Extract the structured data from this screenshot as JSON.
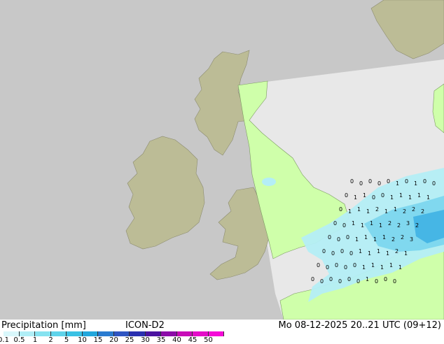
{
  "footer": {
    "title": "Precipitation [mm]",
    "model": "ICON-D2",
    "valid": "Mo 08-12-2025 20..21 UTC (09+12)"
  },
  "legend": {
    "ticks": [
      "0.1",
      "0.5",
      "1",
      "2",
      "5",
      "10",
      "15",
      "20",
      "25",
      "30",
      "35",
      "40",
      "45",
      "50"
    ],
    "colors": [
      "#d9f7fb",
      "#b0eef6",
      "#86e2f0",
      "#5fd3ea",
      "#3ac1e4",
      "#23a7dc",
      "#2a7bd0",
      "#2f55c2",
      "#2a2fb0",
      "#4b12a0",
      "#8c0ca8",
      "#c80cb8",
      "#e40cc8",
      "#f50ad8"
    ]
  },
  "map": {
    "colors": {
      "sea_outside": "#c8c8c8",
      "land_outside": "#bcbc96",
      "sea_domain": "#e8e8e8",
      "land_domain": "#cfffaa",
      "rain_light": "#b4eef6",
      "rain_mid": "#7cd6ee",
      "rain_heavy": "#42b4e4"
    },
    "grid_values": [
      {
        "v": "0"
      },
      {
        "v": "0"
      },
      {
        "v": "0"
      },
      {
        "v": "0"
      },
      {
        "v": "0"
      },
      {
        "v": "1"
      },
      {
        "v": "0"
      },
      {
        "v": "1"
      },
      {
        "v": "0"
      },
      {
        "v": "0"
      },
      {
        "v": "0"
      },
      {
        "v": "1"
      },
      {
        "v": "1"
      },
      {
        "v": "0"
      },
      {
        "v": "0"
      },
      {
        "v": "1"
      },
      {
        "v": "1"
      },
      {
        "v": "1"
      },
      {
        "v": "1"
      },
      {
        "v": "1"
      },
      {
        "v": "0"
      },
      {
        "v": "1"
      },
      {
        "v": "1"
      },
      {
        "v": "1"
      },
      {
        "v": "2"
      },
      {
        "v": "1"
      },
      {
        "v": "1"
      },
      {
        "v": "2"
      },
      {
        "v": "2"
      },
      {
        "v": "2"
      },
      {
        "v": "0"
      },
      {
        "v": "0"
      },
      {
        "v": "1"
      },
      {
        "v": "1"
      },
      {
        "v": "1"
      },
      {
        "v": "1"
      },
      {
        "v": "2"
      },
      {
        "v": "2"
      },
      {
        "v": "3"
      },
      {
        "v": "2"
      },
      {
        "v": "0"
      },
      {
        "v": "0"
      },
      {
        "v": "0"
      },
      {
        "v": "1"
      },
      {
        "v": "1"
      },
      {
        "v": "1"
      },
      {
        "v": "1"
      },
      {
        "v": "2"
      },
      {
        "v": "2"
      },
      {
        "v": "3"
      },
      {
        "v": "0"
      },
      {
        "v": "0"
      },
      {
        "v": "0"
      },
      {
        "v": "0"
      },
      {
        "v": "1"
      },
      {
        "v": "1"
      },
      {
        "v": "1"
      },
      {
        "v": "1"
      },
      {
        "v": "2"
      },
      {
        "v": "1"
      },
      {
        "v": "0"
      },
      {
        "v": "0"
      },
      {
        "v": "0"
      },
      {
        "v": "0"
      },
      {
        "v": "0"
      },
      {
        "v": "1"
      },
      {
        "v": "1"
      },
      {
        "v": "1"
      },
      {
        "v": "1"
      },
      {
        "v": "1"
      },
      {
        "v": "0"
      },
      {
        "v": "0"
      },
      {
        "v": "0"
      },
      {
        "v": "0"
      },
      {
        "v": "0"
      },
      {
        "v": "0"
      },
      {
        "v": "1"
      },
      {
        "v": "0"
      },
      {
        "v": "0"
      },
      {
        "v": "0"
      }
    ]
  }
}
